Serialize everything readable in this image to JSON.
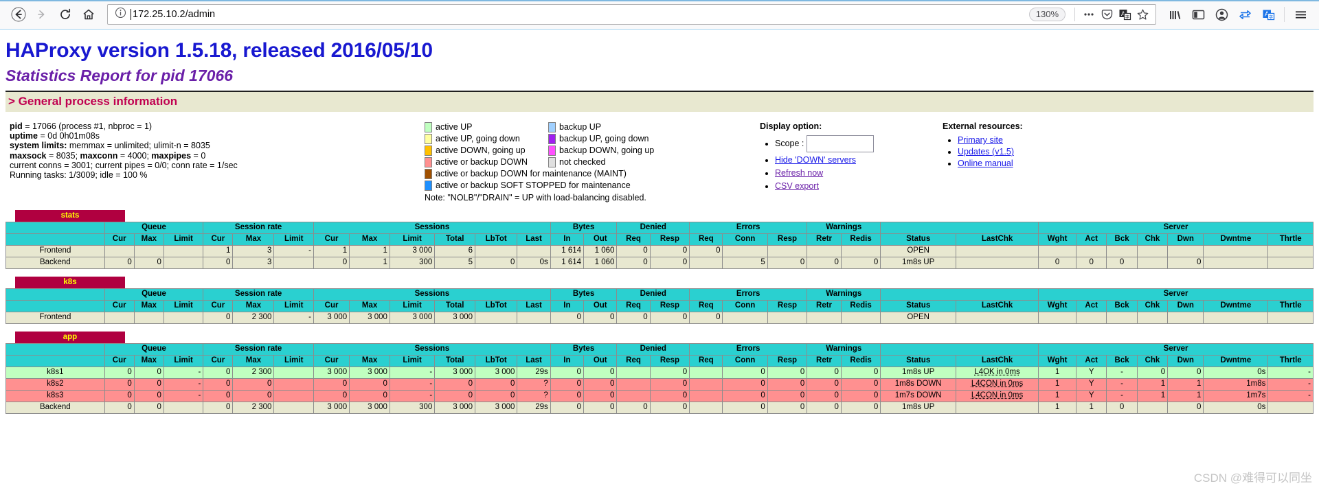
{
  "browser": {
    "url": "172.25.10.2/admin",
    "zoom": "130%",
    "icons": {
      "back": "back-arrow-icon",
      "forward": "forward-arrow-icon",
      "reload": "reload-icon",
      "home": "home-icon",
      "info": "page-info-icon",
      "menu_dots": "ellipsis-icon",
      "pocket": "pocket-icon",
      "translate": "translate-icon",
      "bookmark": "star-icon",
      "library": "library-icon",
      "sidebar": "sidebar-icon",
      "account": "account-icon",
      "sync": "sync-icon",
      "translate2": "translate-panel-icon",
      "hamburger": "hamburger-menu-icon"
    }
  },
  "header": {
    "title": "HAProxy version 1.5.18, released 2016/05/10",
    "subtitle": "Statistics Report for pid 17066"
  },
  "general": {
    "section_title": "> General process information",
    "lines": [
      "pid = 17066 (process #1, nbproc = 1)",
      "uptime = 0d 0h01m08s",
      "system limits: memmax = unlimited; ulimit-n = 8035",
      "maxsock = 8035; maxconn = 4000; maxpipes = 0",
      "current conns = 3001; current pipes = 0/0; conn rate = 1/sec",
      "Running tasks: 1/3009; idle = 100 %"
    ],
    "lines_bold_prefix": [
      "pid",
      "uptime",
      "system limits:",
      "maxsock",
      "",
      ""
    ]
  },
  "legend": {
    "column1": [
      {
        "color": "#c0ffc0",
        "label": "active UP"
      },
      {
        "color": "#ffffa0",
        "label": "active UP, going down"
      },
      {
        "color": "#ffc000",
        "label": "active DOWN, going up"
      },
      {
        "color": "#ff9090",
        "label": "active or backup DOWN"
      },
      {
        "color": "#a05000",
        "label": "active or backup DOWN for maintenance (MAINT)"
      },
      {
        "color": "#1e90ff",
        "label": "active or backup SOFT STOPPED for maintenance"
      }
    ],
    "column2": [
      {
        "color": "#a0d0ff",
        "label": "backup UP"
      },
      {
        "color": "#a020f0",
        "label": "backup UP, going down"
      },
      {
        "color": "#ff50ff",
        "label": "backup DOWN, going up"
      },
      {
        "color": "#e0e0e0",
        "label": "not checked"
      }
    ],
    "note": "Note: \"NOLB\"/\"DRAIN\" = UP with load-balancing disabled."
  },
  "display_option": {
    "title": "Display option:",
    "scope_label": "Scope :",
    "scope_value": "",
    "links": [
      "Hide 'DOWN' servers",
      "Refresh now",
      "CSV export"
    ]
  },
  "external_resources": {
    "title": "External resources:",
    "links": [
      "Primary site",
      "Updates (v1.5)",
      "Online manual"
    ]
  },
  "table_groups": [
    {
      "label": "Queue",
      "cols": [
        "Cur",
        "Max",
        "Limit"
      ]
    },
    {
      "label": "Session rate",
      "cols": [
        "Cur",
        "Max",
        "Limit"
      ]
    },
    {
      "label": "Sessions",
      "cols": [
        "Cur",
        "Max",
        "Limit",
        "Total",
        "LbTot",
        "Last"
      ]
    },
    {
      "label": "Bytes",
      "cols": [
        "In",
        "Out"
      ]
    },
    {
      "label": "Denied",
      "cols": [
        "Req",
        "Resp"
      ]
    },
    {
      "label": "Errors",
      "cols": [
        "Req",
        "Conn",
        "Resp"
      ]
    },
    {
      "label": "Warnings",
      "cols": [
        "Retr",
        "Redis"
      ]
    },
    {
      "label": "",
      "cols": [
        "Status",
        "LastChk"
      ]
    },
    {
      "label": "Server",
      "cols": [
        "Wght",
        "Act",
        "Bck",
        "Chk",
        "Dwn",
        "Dwntme",
        "Thrtle"
      ]
    }
  ],
  "proxies": [
    {
      "name": "stats",
      "rows": [
        {
          "name": "Frontend",
          "style": "be",
          "cells": [
            "",
            "",
            "",
            "1",
            "3",
            "-",
            "1",
            "1",
            "3 000",
            "6",
            "",
            "",
            "1 614",
            "1 060",
            "0",
            "0",
            "0",
            "",
            "",
            "",
            "",
            "OPEN",
            "",
            "",
            "",
            "",
            "",
            "",
            "",
            ""
          ]
        },
        {
          "name": "Backend",
          "style": "be",
          "cells": [
            "0",
            "0",
            "",
            "0",
            "3",
            "",
            "0",
            "1",
            "300",
            "5",
            "0",
            "0s",
            "1 614",
            "1 060",
            "0",
            "0",
            "",
            "5",
            "0",
            "0",
            "0",
            "1m8s UP",
            "",
            "0",
            "0",
            "0",
            "",
            "0",
            "",
            ""
          ]
        }
      ]
    },
    {
      "name": "k8s",
      "rows": [
        {
          "name": "Frontend",
          "style": "be",
          "cells": [
            "",
            "",
            "",
            "0",
            "2 300",
            "-",
            "3 000",
            "3 000",
            "3 000",
            "3 000",
            "",
            "",
            "0",
            "0",
            "0",
            "0",
            "0",
            "",
            "",
            "",
            "",
            "OPEN",
            "",
            "",
            "",
            "",
            "",
            "",
            "",
            ""
          ]
        }
      ]
    },
    {
      "name": "app",
      "rows": [
        {
          "name": "k8s1",
          "style": "up",
          "cells": [
            "0",
            "0",
            "-",
            "0",
            "2 300",
            "",
            "3 000",
            "3 000",
            "-",
            "3 000",
            "3 000",
            "29s",
            "0",
            "0",
            "",
            "0",
            "",
            "0",
            "0",
            "0",
            "0",
            "1m8s UP",
            "L4OK in 0ms",
            "1",
            "Y",
            "-",
            "0",
            "0",
            "0s",
            "-"
          ]
        },
        {
          "name": "k8s2",
          "style": "down",
          "cells": [
            "0",
            "0",
            "-",
            "0",
            "0",
            "",
            "0",
            "0",
            "-",
            "0",
            "0",
            "?",
            "0",
            "0",
            "",
            "0",
            "",
            "0",
            "0",
            "0",
            "0",
            "1m8s DOWN",
            "L4CON in 0ms",
            "1",
            "Y",
            "-",
            "1",
            "1",
            "1m8s",
            "-"
          ]
        },
        {
          "name": "k8s3",
          "style": "down",
          "cells": [
            "0",
            "0",
            "-",
            "0",
            "0",
            "",
            "0",
            "0",
            "-",
            "0",
            "0",
            "?",
            "0",
            "0",
            "",
            "0",
            "",
            "0",
            "0",
            "0",
            "0",
            "1m7s DOWN",
            "L4CON in 0ms",
            "1",
            "Y",
            "-",
            "1",
            "1",
            "1m7s",
            "-"
          ]
        },
        {
          "name": "Backend",
          "style": "be",
          "cells": [
            "0",
            "0",
            "",
            "0",
            "2 300",
            "",
            "3 000",
            "3 000",
            "300",
            "3 000",
            "3 000",
            "29s",
            "0",
            "0",
            "0",
            "0",
            "",
            "0",
            "0",
            "0",
            "0",
            "1m8s UP",
            "",
            "1",
            "1",
            "0",
            "",
            "0",
            "0s",
            ""
          ]
        }
      ]
    }
  ],
  "watermark": "CSDN @难得可以同坐"
}
